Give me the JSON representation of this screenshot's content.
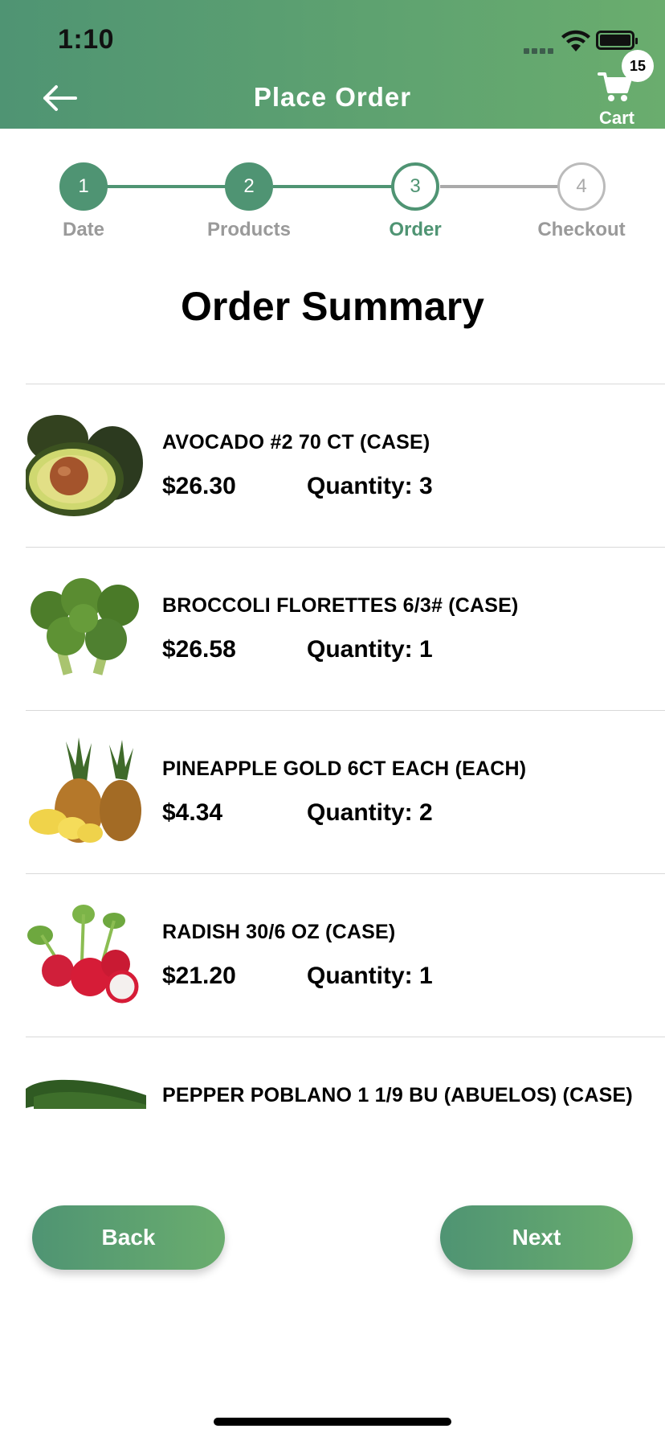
{
  "status_bar": {
    "time": "1:10"
  },
  "header": {
    "title": "Place Order",
    "cart_label": "Cart",
    "cart_count": "15"
  },
  "stepper": {
    "steps": [
      {
        "number": "1",
        "label": "Date",
        "state": "done"
      },
      {
        "number": "2",
        "label": "Products",
        "state": "done"
      },
      {
        "number": "3",
        "label": "Order",
        "state": "active"
      },
      {
        "number": "4",
        "label": "Checkout",
        "state": "todo"
      }
    ]
  },
  "summary": {
    "title": "Order Summary"
  },
  "items": [
    {
      "name": "AVOCADO #2 70 CT (CASE)",
      "price": "$26.30",
      "quantity": "Quantity: 3",
      "image": "avocado-image"
    },
    {
      "name": "BROCCOLI FLORETTES 6/3# (CASE)",
      "price": "$26.58",
      "quantity": "Quantity: 1",
      "image": "broccoli-image"
    },
    {
      "name": "PINEAPPLE GOLD 6CT  EACH (EACH)",
      "price": "$4.34",
      "quantity": "Quantity: 2",
      "image": "pineapple-image"
    },
    {
      "name": "RADISH 30/6 OZ (CASE)",
      "price": "$21.20",
      "quantity": "Quantity: 1",
      "image": "radish-image"
    },
    {
      "name": "PEPPER POBLANO 1 1/9 BU (ABUELOS) (CASE)",
      "price": "",
      "quantity": "",
      "image": "pepper-image"
    }
  ],
  "buttons": {
    "back": "Back",
    "next": "Next"
  },
  "colors": {
    "brand_green": "#4f9473",
    "brand_green_light": "#6aad6e",
    "inactive_gray": "#9a9a9a"
  }
}
